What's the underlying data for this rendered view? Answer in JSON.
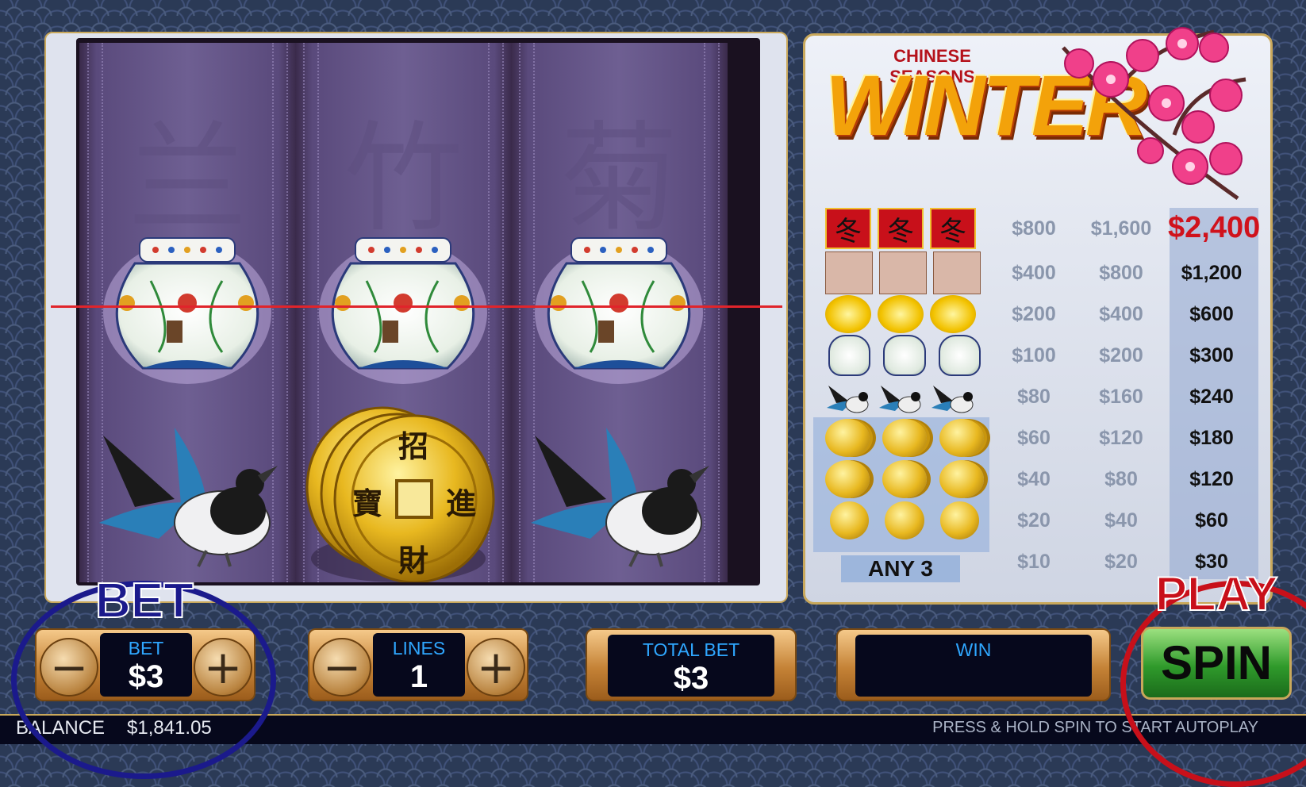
{
  "paytable": {
    "subtitle": "CHINESE SEASONS",
    "title": "WINTER",
    "rows": [
      {
        "symbol": "winter-character",
        "v1": "$800",
        "v2": "$1,600",
        "v3": "$2,400"
      },
      {
        "symbol": "plum-blossom",
        "v1": "$400",
        "v2": "$800",
        "v3": "$1,200"
      },
      {
        "symbol": "yellow-flower",
        "v1": "$200",
        "v2": "$400",
        "v3": "$600"
      },
      {
        "symbol": "porcelain-vase",
        "v1": "$100",
        "v2": "$200",
        "v3": "$300"
      },
      {
        "symbol": "magpie",
        "v1": "$80",
        "v2": "$160",
        "v3": "$240"
      },
      {
        "symbol": "coin-stack-triple",
        "v1": "$60",
        "v2": "$120",
        "v3": "$180"
      },
      {
        "symbol": "coin-stack-double",
        "v1": "$40",
        "v2": "$80",
        "v3": "$120"
      },
      {
        "symbol": "coin-single",
        "v1": "$20",
        "v2": "$40",
        "v3": "$60"
      },
      {
        "symbol": "any-3",
        "v1": "$10",
        "v2": "$20",
        "v3": "$30"
      }
    ],
    "any3_label": "ANY 3"
  },
  "reels": [
    {
      "bg_char": "兰",
      "symbols": [
        "porcelain-vase",
        "magpie"
      ]
    },
    {
      "bg_char": "竹",
      "symbols": [
        "porcelain-vase",
        "coin-stack"
      ]
    },
    {
      "bg_char": "菊",
      "symbols": [
        "porcelain-vase",
        "magpie"
      ]
    }
  ],
  "coin_chars": {
    "top": "招",
    "left": "寶",
    "right": "進",
    "bottom": "財"
  },
  "controls": {
    "bet": {
      "label": "BET",
      "value": "$3"
    },
    "lines": {
      "label": "LINES",
      "value": "1"
    },
    "total_bet": {
      "label": "TOTAL BET",
      "value": "$3"
    },
    "win": {
      "label": "WIN",
      "value": ""
    },
    "minus": "−",
    "plus": "+",
    "spin_label": "SPIN"
  },
  "status": {
    "balance_label": "BALANCE",
    "balance_value": "$1,841.05",
    "hint": "PRESS & HOLD SPIN TO START AUTOPLAY"
  },
  "overlays": {
    "bet_label": "BET",
    "play_label": "PLAY"
  },
  "colors": {
    "payline": "#e0242b",
    "accent_blue": "#2fa7ff",
    "win_red": "#d0121c"
  }
}
